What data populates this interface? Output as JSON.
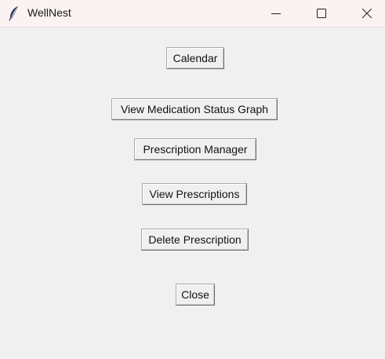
{
  "window": {
    "title": "WellNest",
    "icon": "feather-icon",
    "controls": {
      "minimize": "minimize-icon",
      "maximize": "maximize-icon",
      "close": "close-icon"
    }
  },
  "buttons": {
    "calendar": "Calendar",
    "medication_graph": "View Medication Status Graph",
    "prescription_manager": "Prescription Manager",
    "view_prescriptions": "View Prescriptions",
    "delete_prescription": "Delete Prescription",
    "close": "Close"
  },
  "colors": {
    "titlebar": "#fbf2f2",
    "background": "#f0f0f0",
    "icon": "#2b3a55"
  }
}
